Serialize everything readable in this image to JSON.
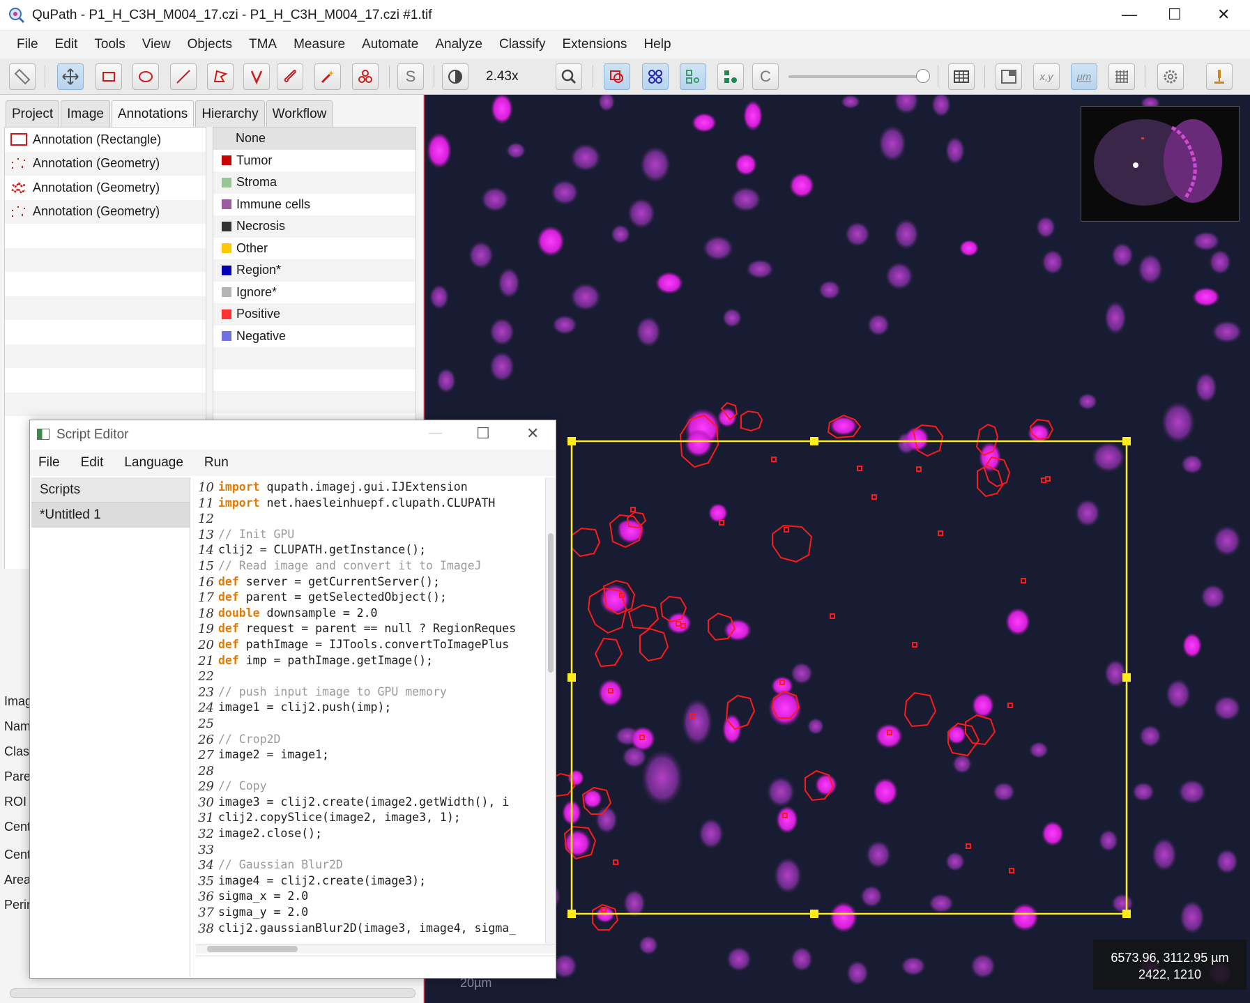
{
  "window": {
    "title": "QuPath - P1_H_C3H_M004_17.czi - P1_H_C3H_M004_17.czi #1.tif",
    "app_icon": "qupath-icon",
    "minimize": "—",
    "maximize": "☐",
    "close": "✕"
  },
  "menu": [
    "File",
    "Edit",
    "Tools",
    "View",
    "Objects",
    "TMA",
    "Measure",
    "Automate",
    "Analyze",
    "Classify",
    "Extensions",
    "Help"
  ],
  "toolbar": {
    "zoom_label": "2.43x",
    "brightness_slider_value": 1.0,
    "xy_label": "x,y",
    "um_label": "μm",
    "s_label": "S",
    "c_label": "C"
  },
  "tabs": [
    "Project",
    "Image",
    "Annotations",
    "Hierarchy",
    "Workflow"
  ],
  "annotations": [
    {
      "label": "Annotation (Rectangle)",
      "icon": "rectangle-roi-icon"
    },
    {
      "label": "Annotation (Geometry)",
      "icon": "geometry-roi-icon"
    },
    {
      "label": "Annotation (Geometry)",
      "icon": "geometry-roi-icon"
    },
    {
      "label": "Annotation (Geometry)",
      "icon": "geometry-roi-icon"
    }
  ],
  "classes": [
    {
      "label": "None",
      "color": ""
    },
    {
      "label": "Tumor",
      "color": "#c80000"
    },
    {
      "label": "Stroma",
      "color": "#96c896"
    },
    {
      "label": "Immune cells",
      "color": "#a05aa0"
    },
    {
      "label": "Necrosis",
      "color": "#323232"
    },
    {
      "label": "Other",
      "color": "#ffc800"
    },
    {
      "label": "Region*",
      "color": "#0000b4"
    },
    {
      "label": "Ignore*",
      "color": "#b4b4b4"
    },
    {
      "label": "Positive",
      "color": "#ff3232"
    },
    {
      "label": "Negative",
      "color": "#7070e0"
    }
  ],
  "properties_labels": [
    "Imag",
    "Nam",
    "Class",
    "Pare",
    "ROI",
    "Cent",
    "Cent",
    "Area",
    "Perir"
  ],
  "viewer": {
    "coords_um": "6573.96, 3112.95 µm",
    "coords_px": "2422, 1210",
    "scalebar": "20µm"
  },
  "script_editor": {
    "title": "Script Editor",
    "menu": [
      "File",
      "Edit",
      "Language",
      "Run"
    ],
    "scripts_header": "Scripts",
    "script_item": "*Untitled 1",
    "lines": [
      {
        "n": "10",
        "kw": "import",
        "text": " qupath.imagej.gui.IJExtension",
        "type": "code"
      },
      {
        "n": "11",
        "kw": "import",
        "text": " net.haesleinhuepf.clupath.CLUPATH",
        "type": "code"
      },
      {
        "n": "12",
        "kw": "",
        "text": "",
        "type": "code"
      },
      {
        "n": "13",
        "kw": "",
        "text": "// Init GPU",
        "type": "comment"
      },
      {
        "n": "14",
        "kw": "",
        "text": "clij2 = CLUPATH.getInstance();",
        "type": "code"
      },
      {
        "n": "15",
        "kw": "",
        "text": "// Read image and convert it to ImageJ",
        "type": "comment"
      },
      {
        "n": "16",
        "kw": "def",
        "text": " server = getCurrentServer();",
        "type": "code"
      },
      {
        "n": "17",
        "kw": "def",
        "text": " parent = getSelectedObject();",
        "type": "code"
      },
      {
        "n": "18",
        "kw": "double",
        "text": " downsample = 2.0",
        "type": "code"
      },
      {
        "n": "19",
        "kw": "def",
        "text": " request = parent == null ? RegionReques",
        "type": "code"
      },
      {
        "n": "20",
        "kw": "def",
        "text": " pathImage = IJTools.convertToImagePlus",
        "type": "code"
      },
      {
        "n": "21",
        "kw": "def",
        "text": " imp = pathImage.getImage();",
        "type": "code"
      },
      {
        "n": "22",
        "kw": "",
        "text": "",
        "type": "code"
      },
      {
        "n": "23",
        "kw": "",
        "text": "// push input image to GPU memory",
        "type": "comment"
      },
      {
        "n": "24",
        "kw": "",
        "text": "image1 = clij2.push(imp);",
        "type": "code"
      },
      {
        "n": "25",
        "kw": "",
        "text": "",
        "type": "code"
      },
      {
        "n": "26",
        "kw": "",
        "text": "// Crop2D",
        "type": "comment"
      },
      {
        "n": "27",
        "kw": "",
        "text": "image2 = image1;",
        "type": "code"
      },
      {
        "n": "28",
        "kw": "",
        "text": "",
        "type": "code"
      },
      {
        "n": "29",
        "kw": "",
        "text": "// Copy",
        "type": "comment"
      },
      {
        "n": "30",
        "kw": "",
        "text": "image3 = clij2.create(image2.getWidth(), i",
        "type": "code"
      },
      {
        "n": "31",
        "kw": "",
        "text": "clij2.copySlice(image2, image3, 1);",
        "type": "code"
      },
      {
        "n": "32",
        "kw": "",
        "text": "image2.close();",
        "type": "code"
      },
      {
        "n": "33",
        "kw": "",
        "text": "",
        "type": "code"
      },
      {
        "n": "34",
        "kw": "",
        "text": "// Gaussian Blur2D",
        "type": "comment"
      },
      {
        "n": "35",
        "kw": "",
        "text": "image4 = clij2.create(image3);",
        "type": "code"
      },
      {
        "n": "36",
        "kw": "",
        "text": "sigma_x = 2.0",
        "type": "code"
      },
      {
        "n": "37",
        "kw": "",
        "text": "sigma_y = 2.0",
        "type": "code"
      },
      {
        "n": "38",
        "kw": "",
        "text": "clij2.gaussianBlur2D(image3, image4, sigma_",
        "type": "code"
      }
    ]
  }
}
